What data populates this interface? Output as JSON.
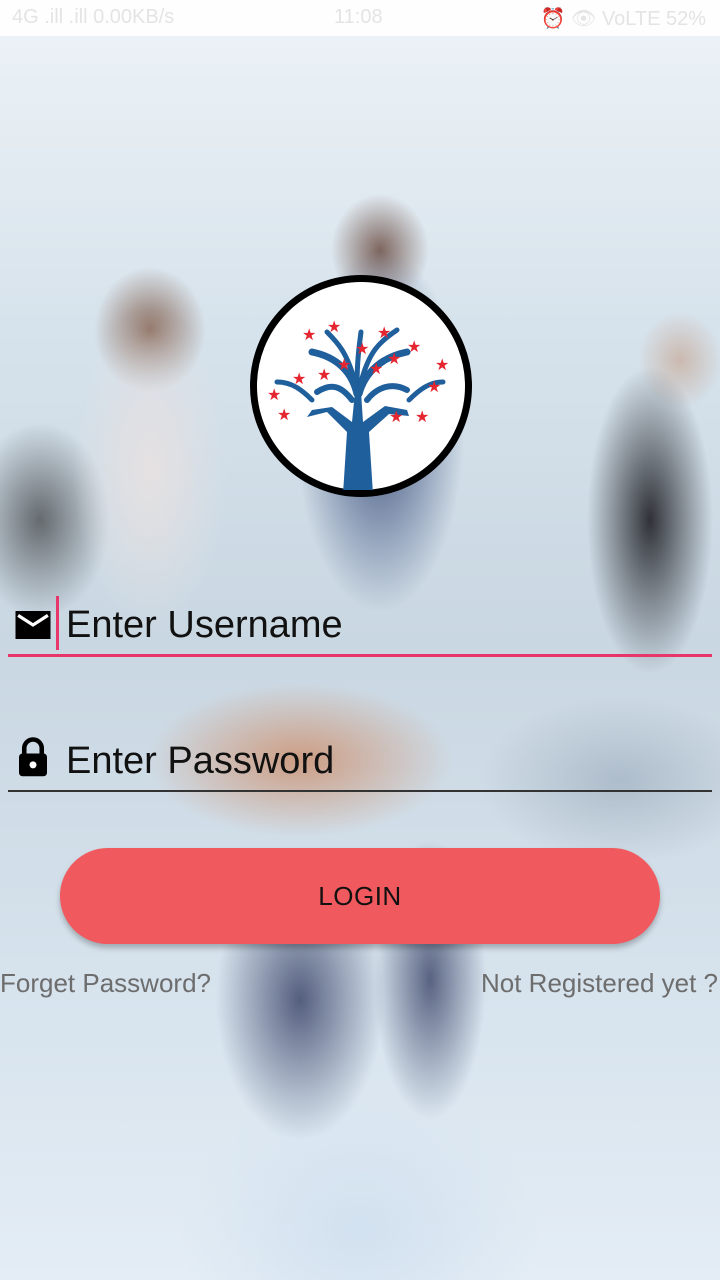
{
  "status_bar": {
    "left": "4G .ill .ill 0.00KB/s",
    "time": "11:08",
    "right": "⏰ 👁 VoLTE 52%"
  },
  "login": {
    "username_placeholder": "Enter Username",
    "password_placeholder": "Enter Password",
    "login_label": "LOGIN",
    "forget_password": "Forget Password?",
    "not_registered": "Not Registered yet ?"
  },
  "colors": {
    "accent": "#e8356a",
    "button": "#f0595d",
    "logo_blue": "#1f5f9c",
    "logo_star": "#e52530"
  },
  "icons": [
    "email-icon",
    "lock-icon",
    "logo-tree-hands-stars"
  ]
}
